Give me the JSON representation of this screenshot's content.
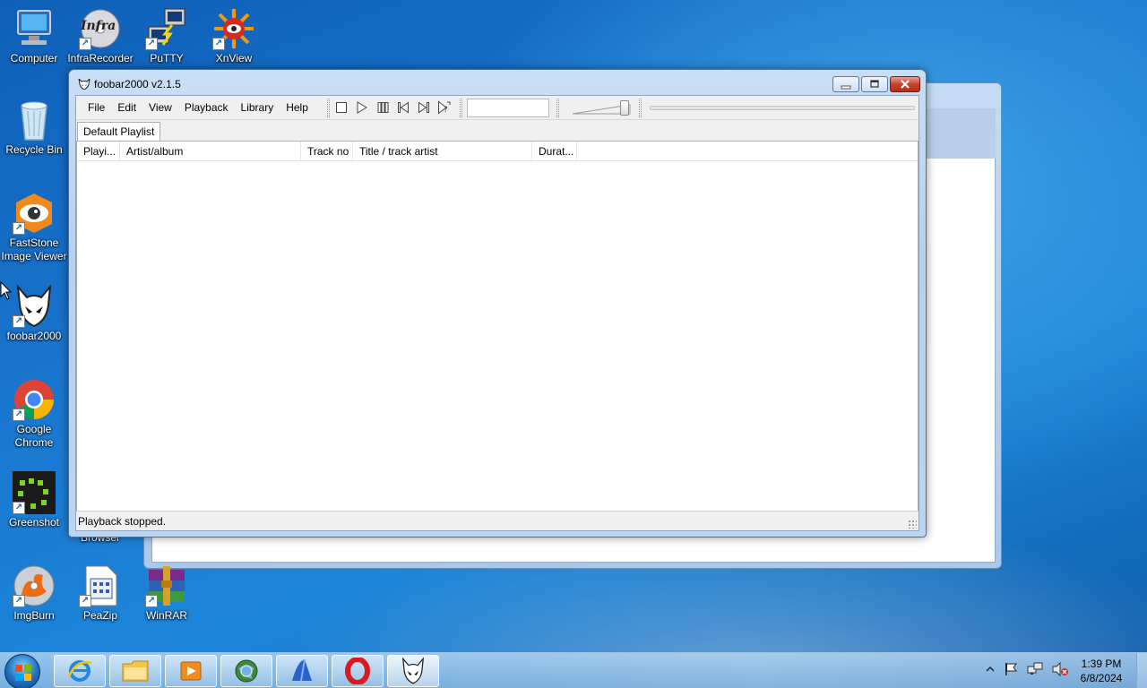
{
  "desktop": {
    "icons": [
      {
        "label": "Computer",
        "icon": "computer-icon"
      },
      {
        "label": "InfraRecorder",
        "icon": "infrarecorder-icon",
        "overlay_text": "Infra"
      },
      {
        "label": "PuTTY",
        "icon": "putty-icon"
      },
      {
        "label": "XnView",
        "icon": "xnview-icon"
      },
      {
        "label": "Recycle Bin",
        "icon": "recycle-bin-icon"
      },
      {
        "label": "FastStone Image Viewer",
        "icon": "faststone-icon"
      },
      {
        "label": "foobar2000",
        "icon": "foobar2000-icon"
      },
      {
        "label": "Google Chrome",
        "icon": "chrome-icon"
      },
      {
        "label": "Greenshot",
        "icon": "greenshot-icon"
      },
      {
        "label": "Browser",
        "icon": "browser-partial"
      },
      {
        "label": "ImgBurn",
        "icon": "imgburn-icon"
      },
      {
        "label": "PeaZip",
        "icon": "peazip-icon"
      },
      {
        "label": "WinRAR",
        "icon": "winrar-icon"
      }
    ]
  },
  "window": {
    "title": "foobar2000 v2.1.5",
    "controls": {
      "minimize": "minimize",
      "maximize": "maximize",
      "close": "close"
    },
    "menu": [
      "File",
      "Edit",
      "View",
      "Playback",
      "Library",
      "Help"
    ],
    "transport": [
      "stop-icon",
      "play-icon",
      "pause-icon",
      "previous-icon",
      "next-icon",
      "random-icon"
    ],
    "tab": "Default Playlist",
    "columns": [
      "Playi...",
      "Artist/album",
      "Track no",
      "Title / track artist",
      "Durat..."
    ],
    "status": "Playback stopped.",
    "volume_level": 0.95,
    "seek_position": 0
  },
  "taskbar": {
    "pinned": [
      "internet-explorer-icon",
      "file-explorer-icon",
      "media-player-icon",
      "browser-globe-icon",
      "app-blue-icon",
      "opera-icon",
      "foobar2000-taskbar-icon"
    ],
    "active": "foobar2000-taskbar-icon",
    "tray": [
      "show-hidden-icons-icon",
      "action-center-flag-icon",
      "network-icon",
      "volume-muted-icon"
    ],
    "time": "1:39 PM",
    "date": "6/8/2024"
  }
}
